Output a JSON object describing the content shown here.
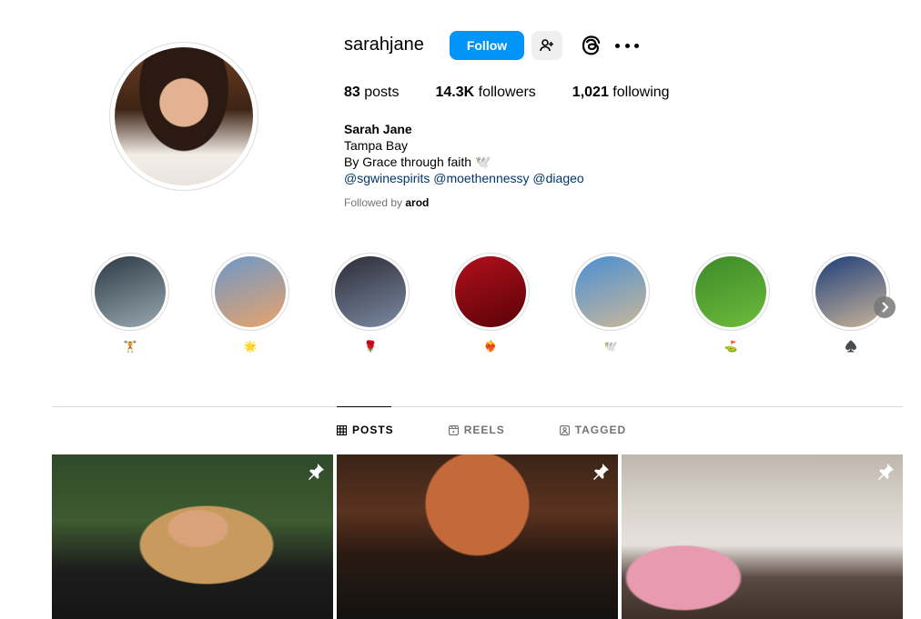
{
  "profile": {
    "username": "sarahjane",
    "follow_label": "Follow",
    "stats": {
      "posts_count": "83",
      "posts_label": "posts",
      "followers_count": "14.3K",
      "followers_label": "followers",
      "following_count": "1,021",
      "following_label": "following"
    },
    "bio": {
      "name": "Sarah Jane",
      "location": "Tampa Bay",
      "tagline": "By Grace through faith 🕊️",
      "mentions": [
        "@sgwinespirits",
        "@moethennessy",
        "@diageo"
      ]
    },
    "followed_by_prefix": "Followed by",
    "followed_by_user": "arod"
  },
  "highlights": [
    {
      "label": "🏋️",
      "color_a": "#2b3a44",
      "color_b": "#9aa7b1"
    },
    {
      "label": "🌟",
      "color_a": "#6e98c9",
      "color_b": "#e8a36a"
    },
    {
      "label": "🌹",
      "color_a": "#2c2c36",
      "color_b": "#7b8aa3"
    },
    {
      "label": "❤️‍🔥",
      "color_a": "#b0101c",
      "color_b": "#5a0208"
    },
    {
      "label": "🕊️",
      "color_a": "#4a8fd4",
      "color_b": "#c9b79a"
    },
    {
      "label": "⛳",
      "color_a": "#3c8a2a",
      "color_b": "#6dbb3a"
    },
    {
      "label": "♠️",
      "color_a": "#1e3f7a",
      "color_b": "#c9b49a"
    }
  ],
  "tabs": [
    {
      "label": "POSTS",
      "icon": "grid-icon",
      "active": true
    },
    {
      "label": "REELS",
      "icon": "reels-icon",
      "active": false
    },
    {
      "label": "TAGGED",
      "icon": "tagged-icon",
      "active": false
    }
  ],
  "posts": [
    {
      "pinned": true,
      "icon": "pin-icon"
    },
    {
      "pinned": true,
      "icon": "pin-icon"
    },
    {
      "pinned": true,
      "icon": "pin-icon"
    }
  ],
  "colors": {
    "accent": "#0095f6",
    "link": "#00376b",
    "muted": "#737373",
    "border": "#dbdbdb"
  }
}
